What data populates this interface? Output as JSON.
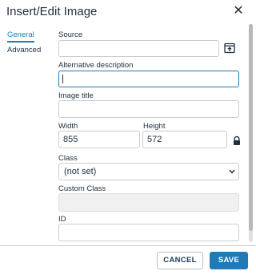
{
  "dialog": {
    "title": "Insert/Edit Image"
  },
  "tabs": [
    {
      "label": "General",
      "active": true
    },
    {
      "label": "Advanced",
      "active": false
    }
  ],
  "form": {
    "source": {
      "label": "Source",
      "value": ""
    },
    "alt": {
      "label": "Alternative description",
      "value": ""
    },
    "title": {
      "label": "Image title",
      "value": ""
    },
    "width": {
      "label": "Width",
      "value": "855"
    },
    "height": {
      "label": "Height",
      "value": "572"
    },
    "class": {
      "label": "Class",
      "value": "(not set)"
    },
    "custom_class": {
      "label": "Custom Class",
      "value": ""
    },
    "id": {
      "label": "ID",
      "value": ""
    }
  },
  "buttons": {
    "cancel": "CANCEL",
    "save": "SAVE"
  },
  "colors": {
    "accent": "#207ab7",
    "text": "#222f3e",
    "border": "#cccccc"
  },
  "icons": [
    "close-icon",
    "browse-icon",
    "lock-icon",
    "chevron-down-icon"
  ]
}
